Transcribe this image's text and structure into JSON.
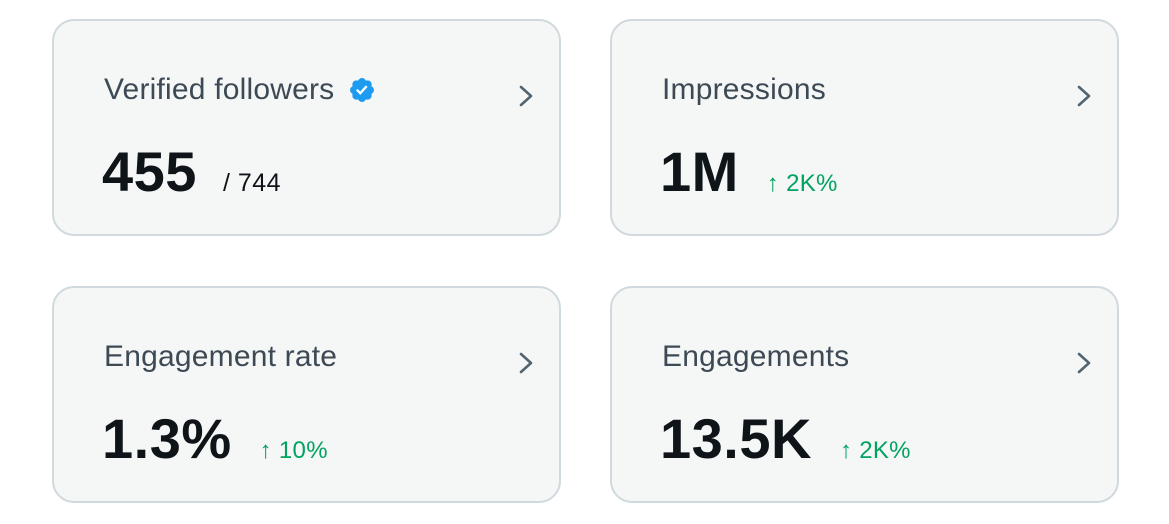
{
  "colors": {
    "card_background": "#f5f7f6",
    "card_border": "#cfd9de",
    "title_text": "#3d4a55",
    "value_text": "#0f1419",
    "positive_change": "#00a35f",
    "verified_badge": "#1d9bf0"
  },
  "cards": [
    {
      "title": "Verified followers",
      "badge_icon": "verified-badge-icon",
      "value": "455",
      "sub_value": "/ 744",
      "chevron_icon": "chevron-right-icon"
    },
    {
      "title": "Impressions",
      "value": "1M",
      "change": "↑ 2K%",
      "chevron_icon": "chevron-right-icon"
    },
    {
      "title": "Engagement rate",
      "value": "1.3%",
      "change": "↑ 10%",
      "chevron_icon": "chevron-right-icon"
    },
    {
      "title": "Engagements",
      "value": "13.5K",
      "change": "↑ 2K%",
      "chevron_icon": "chevron-right-icon"
    }
  ]
}
